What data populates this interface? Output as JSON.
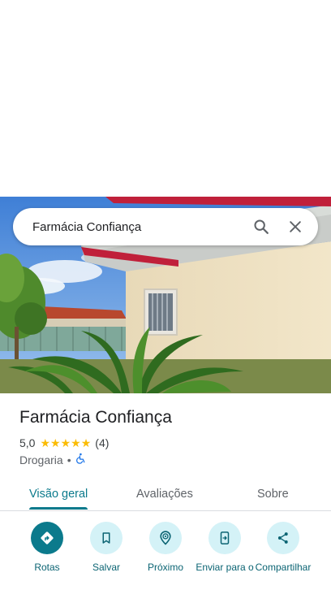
{
  "search": {
    "value": "Farmácia Confiança"
  },
  "place": {
    "name": "Farmácia Confiança",
    "rating": "5,0",
    "stars": 5,
    "review_count": "(4)",
    "category": "Drogaria",
    "separator": "•"
  },
  "tabs": [
    {
      "label": "Visão geral",
      "active": true
    },
    {
      "label": "Avaliações",
      "active": false
    },
    {
      "label": "Sobre",
      "active": false
    }
  ],
  "actions": [
    {
      "label": "Rotas",
      "icon": "directions-icon"
    },
    {
      "label": "Salvar",
      "icon": "bookmark-icon"
    },
    {
      "label": "Próximo",
      "icon": "nearby-icon"
    },
    {
      "label": "Enviar para o",
      "icon": "send-to-phone-icon"
    },
    {
      "label": "Compartilhar",
      "icon": "share-icon"
    }
  ],
  "colors": {
    "accent": "#0b7a8c",
    "action_bg": "#d4f2f7",
    "star": "#fbbc04",
    "accessible": "#1a73e8"
  }
}
